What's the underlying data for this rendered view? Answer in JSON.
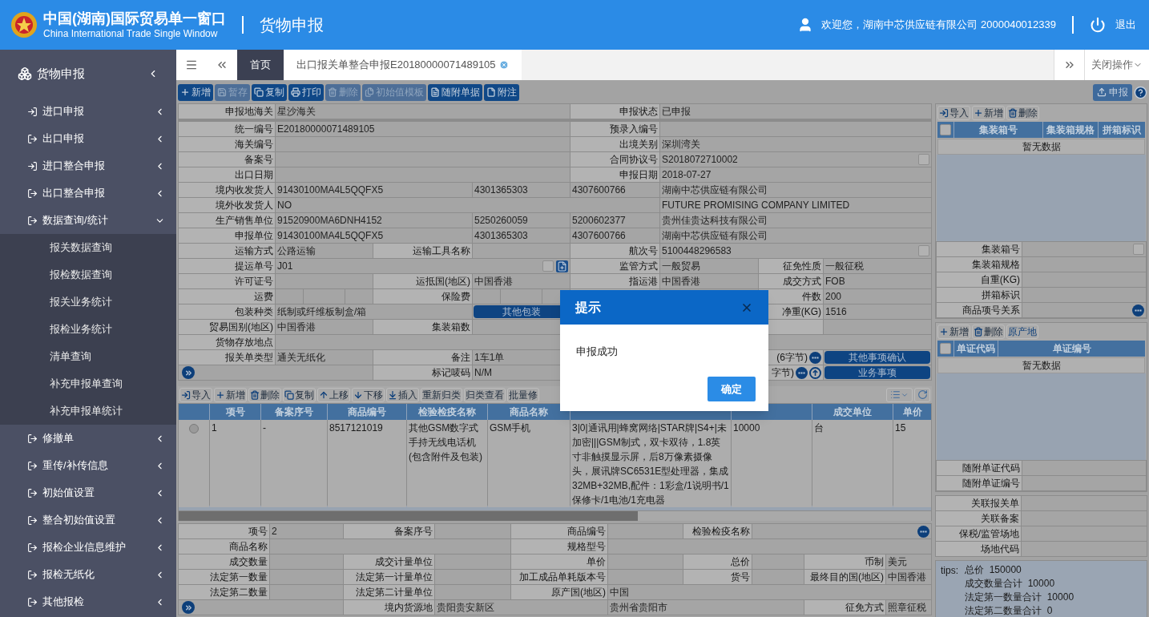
{
  "header": {
    "title": "中国(湖南)国际贸易单一窗口",
    "subtitle": "China International Trade Single Window",
    "page_title": "货物申报",
    "welcome": "欢迎您，湖南中芯供应链有限公司 2000040012339",
    "logout": "退出"
  },
  "sidebar": {
    "title": "货物申报",
    "items": [
      {
        "label": "进口申报",
        "expanded": false
      },
      {
        "label": "出口申报",
        "expanded": false
      },
      {
        "label": "进口整合申报",
        "expanded": false
      },
      {
        "label": "出口整合申报",
        "expanded": false
      },
      {
        "label": "数据查询/统计",
        "expanded": true,
        "children": [
          {
            "label": "报关数据查询"
          },
          {
            "label": "报检数据查询"
          },
          {
            "label": "报关业务统计"
          },
          {
            "label": "报检业务统计"
          },
          {
            "label": "清单查询"
          },
          {
            "label": "补充申报单查询"
          },
          {
            "label": "补充申报单统计"
          }
        ]
      },
      {
        "label": "修撤单",
        "expanded": false
      },
      {
        "label": "重传/补传信息",
        "expanded": false
      },
      {
        "label": "初始值设置",
        "expanded": false
      },
      {
        "label": "整合初始值设置",
        "expanded": false
      },
      {
        "label": "报检企业信息维护",
        "expanded": false
      },
      {
        "label": "报检无纸化",
        "expanded": false
      },
      {
        "label": "其他报检",
        "expanded": false
      }
    ]
  },
  "tabs": [
    {
      "label": "首页",
      "selected": false,
      "closable": false
    },
    {
      "label": "出口报关单整合申报E20180000071489105",
      "selected": true,
      "closable": true
    }
  ],
  "close_ops": "关闭操作",
  "toolbar": [
    {
      "label": "新增",
      "disabled": false
    },
    {
      "label": "暂存",
      "disabled": true
    },
    {
      "label": "复制",
      "disabled": false
    },
    {
      "label": "打印",
      "disabled": false
    },
    {
      "label": "删除",
      "disabled": true
    },
    {
      "label": "初始值模板",
      "disabled": true
    },
    {
      "label": "随附单据",
      "disabled": false
    },
    {
      "label": "附注",
      "disabled": false
    }
  ],
  "submit_button": "申报",
  "form": {
    "rows": [
      [
        {
          "kind": "label",
          "text": "申报地海关"
        },
        {
          "kind": "value",
          "text": "星沙海关"
        },
        "",
        "",
        {
          "kind": "label",
          "text": "申报状态"
        },
        {
          "kind": "value",
          "text": "已申报"
        },
        "",
        ""
      ],
      [
        {
          "kind": "label",
          "text": "统一编号"
        },
        {
          "kind": "value",
          "text": "E20180000071489105"
        },
        "",
        "",
        {
          "kind": "label",
          "text": "预录入编号"
        },
        {
          "kind": "value"
        },
        "",
        ""
      ],
      [
        {
          "kind": "label",
          "text": "海关编号"
        },
        {
          "kind": "value"
        },
        "",
        "",
        {
          "kind": "label",
          "text": "出境关别"
        },
        {
          "kind": "value",
          "text": "深圳湾关"
        },
        "",
        ""
      ],
      [
        {
          "kind": "label",
          "text": "备案号"
        },
        {
          "kind": "value"
        },
        "",
        "",
        {
          "kind": "label",
          "text": "合同协议号"
        },
        {
          "kind": "value",
          "text": "S2018072710002",
          "checked": false
        },
        "",
        ""
      ],
      [
        {
          "kind": "label",
          "text": "出口日期"
        },
        {
          "kind": "value"
        },
        "",
        "",
        {
          "kind": "label",
          "text": "申报日期"
        },
        {
          "kind": "value",
          "text": "2018-07-27"
        },
        "",
        ""
      ],
      [
        {
          "kind": "label",
          "text": "境内收发货人"
        },
        {
          "kind": "value",
          "text": "91430100MA4L5QQFX5"
        },
        "",
        {
          "kind": "value",
          "text": "4301365303"
        },
        {
          "kind": "value",
          "text": "4307600766"
        },
        {
          "kind": "value",
          "text": "湖南中芯供应链有限公司"
        },
        "",
        ""
      ],
      [
        {
          "kind": "label",
          "text": "境外收发货人"
        },
        {
          "kind": "value",
          "text": "NO"
        },
        "",
        "",
        "",
        {
          "kind": "value",
          "text": "FUTURE PROMISING COMPANY LIMITED"
        },
        "",
        ""
      ],
      [
        {
          "kind": "label",
          "text": "生产销售单位"
        },
        {
          "kind": "value",
          "text": "91520900MA6DNH4152"
        },
        "",
        {
          "kind": "value",
          "text": "5250260059"
        },
        {
          "kind": "value",
          "text": "5200602377"
        },
        {
          "kind": "value",
          "text": "贵州佳贵达科技有限公司"
        },
        "",
        ""
      ],
      [
        {
          "kind": "label",
          "text": "申报单位"
        },
        {
          "kind": "value",
          "text": "91430100MA4L5QQFX5"
        },
        "",
        {
          "kind": "value",
          "text": "4301365303"
        },
        {
          "kind": "value",
          "text": "4307600766"
        },
        {
          "kind": "value",
          "text": "湖南中芯供应链有限公司"
        },
        "",
        ""
      ],
      [
        {
          "kind": "label",
          "text": "运输方式"
        },
        {
          "kind": "value",
          "text": "公路运输"
        },
        {
          "kind": "label",
          "text": "运输工具名称"
        },
        {
          "kind": "value"
        },
        {
          "kind": "label",
          "text": "航次号"
        },
        {
          "kind": "value",
          "text": "5100448296583",
          "checked": false
        },
        "",
        ""
      ],
      [
        {
          "kind": "label",
          "text": "提运单号"
        },
        {
          "kind": "lookup",
          "text": "J01",
          "checked": false
        },
        "",
        "",
        {
          "kind": "label",
          "text": "监管方式"
        },
        {
          "kind": "value",
          "text": "一般贸易"
        },
        {
          "kind": "label",
          "text": "征免性质"
        },
        {
          "kind": "value",
          "text": "一般征税"
        }
      ],
      [
        {
          "kind": "label",
          "text": "许可证号"
        },
        {
          "kind": "value"
        },
        {
          "kind": "label",
          "text": "运抵国(地区)"
        },
        {
          "kind": "value",
          "text": "中国香港"
        },
        {
          "kind": "label",
          "text": "指运港"
        },
        {
          "kind": "value",
          "text": "中国香港"
        },
        {
          "kind": "label",
          "text": "成交方式"
        },
        {
          "kind": "value",
          "text": "FOB"
        }
      ],
      [
        {
          "kind": "label",
          "text": "运费"
        },
        {
          "kind": "split"
        },
        {
          "kind": "label",
          "text": "保险费"
        },
        {
          "kind": "split"
        },
        {
          "kind": "label"
        },
        {
          "kind": "value"
        },
        {
          "kind": "label",
          "text": "件数"
        },
        {
          "kind": "value",
          "text": "200"
        }
      ],
      [
        {
          "kind": "label",
          "text": "包装种类"
        },
        {
          "kind": "value",
          "text": "纸制或纤维板制盒/箱"
        },
        "",
        {
          "kind": "button",
          "text": "其他包装"
        },
        null,
        null,
        {
          "kind": "label",
          "text": "净重(KG)"
        },
        {
          "kind": "value",
          "text": "1516"
        }
      ],
      [
        {
          "kind": "label",
          "text": "贸易国别(地区)"
        },
        {
          "kind": "value",
          "text": "中国香港"
        },
        {
          "kind": "label",
          "text": "集装箱数"
        },
        {
          "kind": "value"
        },
        null,
        null,
        {
          "kind": "label"
        },
        {
          "kind": "value"
        }
      ],
      [
        {
          "kind": "label",
          "text": "货物存放地点"
        },
        {
          "kind": "value"
        },
        "",
        "",
        {
          "kind": "label"
        },
        {
          "kind": "value"
        },
        "",
        ""
      ],
      [
        {
          "kind": "label",
          "text": "报关单类型"
        },
        {
          "kind": "value",
          "text": "通关无纸化"
        },
        {
          "kind": "label",
          "text": "备注"
        },
        {
          "kind": "value",
          "text": "1车1单"
        },
        "",
        "",
        {
          "kind": "note",
          "text": "(6字节)",
          "extra_icon": false
        },
        {
          "kind": "button",
          "text": "其他事项确认"
        }
      ],
      [
        {
          "kind": "expand"
        },
        "",
        {
          "kind": "label",
          "text": "标记唛码"
        },
        {
          "kind": "value",
          "text": "N/M"
        },
        "",
        "",
        {
          "kind": "note",
          "text": "字节)",
          "extra_icon": true
        },
        {
          "kind": "button",
          "text": "业务事项"
        }
      ]
    ]
  },
  "goods_toolbar": [
    {
      "label": "导入"
    },
    {
      "label": "新增"
    },
    {
      "label": "删除"
    },
    {
      "label": "复制"
    },
    {
      "label": "上移"
    },
    {
      "label": "下移"
    },
    {
      "label": "插入"
    },
    {
      "label": "重新归类"
    },
    {
      "label": "归类查看"
    },
    {
      "label": "批量修"
    }
  ],
  "goods_table": {
    "columns": [
      {
        "label": "项号"
      },
      {
        "label": "备案序号"
      },
      {
        "label": "商品编号"
      },
      {
        "label": "检验检疫名称"
      },
      {
        "label": "商品名称"
      },
      {},
      {},
      {
        "label": "成交单位"
      },
      {
        "label": "单价"
      }
    ],
    "rows": [
      {
        "selected": false,
        "cells": [
          "1",
          "-",
          "8517121019",
          "其他GSM数字式手持无线电话机(包含附件及包装)",
          "GSM手机",
          "3|0|通讯用|蜂窝网络|STAR牌|S4+|未加密|||GSM制式，双卡双待，1.8英寸非触摸显示屏，后8万像素摄像头，展讯牌SC6531E型处理器，集成32MB+32MB,配件：1彩盒/1说明书/1保修卡/1电池/1充电器",
          "10000",
          "台",
          "15"
        ]
      }
    ]
  },
  "goods_form": {
    "rows": [
      [
        {
          "kind": "label",
          "text": "项号"
        },
        {
          "kind": "value",
          "text": "2"
        },
        {
          "kind": "label",
          "text": "备案序号"
        },
        {
          "kind": "value"
        },
        {
          "kind": "label",
          "text": "商品编号"
        },
        {
          "kind": "value"
        },
        {
          "kind": "label",
          "text": "检验检疫名称"
        },
        {
          "kind": "picker"
        },
        "",
        ""
      ],
      [
        {
          "kind": "label",
          "text": "商品名称"
        },
        {
          "kind": "value"
        },
        "",
        "",
        {
          "kind": "label",
          "text": "规格型号"
        },
        {
          "kind": "value"
        },
        "",
        "",
        "",
        ""
      ],
      [
        {
          "kind": "label",
          "text": "成交数量"
        },
        {
          "kind": "value"
        },
        {
          "kind": "label",
          "text": "成交计量单位"
        },
        {
          "kind": "value"
        },
        {
          "kind": "label",
          "text": "单价"
        },
        {
          "kind": "value"
        },
        {
          "kind": "label",
          "text": "总价"
        },
        {
          "kind": "value"
        },
        {
          "kind": "label",
          "text": "币制"
        },
        {
          "kind": "value",
          "text": "美元"
        }
      ],
      [
        {
          "kind": "label",
          "text": "法定第一数量"
        },
        {
          "kind": "value"
        },
        {
          "kind": "label",
          "text": "法定第一计量单位"
        },
        {
          "kind": "value"
        },
        {
          "kind": "label",
          "text": "加工成品单耗版本号"
        },
        {
          "kind": "value"
        },
        {
          "kind": "label",
          "text": "货号"
        },
        {
          "kind": "value"
        },
        {
          "kind": "label",
          "text": "最终目的国(地区)"
        },
        {
          "kind": "value",
          "text": "中国香港"
        }
      ],
      [
        {
          "kind": "label",
          "text": "法定第二数量"
        },
        {
          "kind": "value"
        },
        {
          "kind": "label",
          "text": "法定第二计量单位"
        },
        {
          "kind": "value"
        },
        {
          "kind": "label",
          "text": "原产国(地区)"
        },
        {
          "kind": "value",
          "text": "中国"
        },
        "",
        "",
        "",
        ""
      ],
      [
        {
          "kind": "expand"
        },
        "",
        {
          "kind": "label",
          "text": "境内货源地"
        },
        {
          "kind": "value",
          "text": "贵阳贵安新区"
        },
        "",
        {
          "kind": "value",
          "text": "贵州省贵阳市"
        },
        "",
        "",
        {
          "kind": "label",
          "text": "征免方式"
        },
        {
          "kind": "value",
          "text": "照章征税"
        }
      ]
    ]
  },
  "container_panel": {
    "toolbar": [
      {
        "label": "导入"
      },
      {
        "label": "新增"
      },
      {
        "label": "删除"
      }
    ],
    "select_all": {
      "checked": false
    },
    "columns": [
      {
        "label": "集装箱号"
      },
      {
        "label": "集装箱规格"
      },
      {
        "label": "拼箱标识"
      }
    ],
    "empty_text": "暂无数据",
    "form": {
      "rows": [
        [
          {
            "kind": "label",
            "text": "集装箱号"
          },
          {
            "kind": "value",
            "checked": false
          }
        ],
        [
          {
            "kind": "label",
            "text": "集装箱规格"
          },
          {
            "kind": "value"
          }
        ],
        [
          {
            "kind": "label",
            "text": "自重(KG)"
          },
          {
            "kind": "value"
          }
        ],
        [
          {
            "kind": "label",
            "text": "拼箱标识"
          },
          {
            "kind": "value"
          }
        ],
        [
          {
            "kind": "label",
            "text": "商品项号关系"
          },
          {
            "kind": "picker"
          }
        ]
      ]
    }
  },
  "document_panel": {
    "toolbar": [
      {
        "label": "新增"
      },
      {
        "label": "删除"
      },
      {
        "label": "原产地"
      }
    ],
    "select_all": {
      "checked": false
    },
    "columns": [
      {
        "label": "单证代码"
      },
      {
        "label": "单证编号"
      }
    ],
    "empty_text": "暂无数据",
    "form": {
      "rows": [
        [
          {
            "kind": "label",
            "text": "随附单证代码"
          },
          {
            "kind": "value"
          }
        ],
        [
          {
            "kind": "label",
            "text": "随附单证编号"
          },
          {
            "kind": "value"
          }
        ]
      ]
    }
  },
  "related_form": {
    "rows": [
      [
        {
          "kind": "label",
          "text": "关联报关单"
        },
        {
          "kind": "value"
        }
      ],
      [
        {
          "kind": "label",
          "text": "关联备案"
        },
        {
          "kind": "value"
        }
      ],
      [
        {
          "kind": "label",
          "text": "保税/监管场地"
        },
        {
          "kind": "value"
        }
      ],
      [
        {
          "kind": "label",
          "text": "场地代码"
        },
        {
          "kind": "value"
        }
      ]
    ]
  },
  "tips": {
    "label": "tips:",
    "lines": [
      "总价  150000",
      "成交数量合计  10000",
      "法定第一数量合计  10000",
      "法定第二数量合计  0"
    ]
  },
  "dialog": {
    "title": "提示",
    "message": "申报成功",
    "ok": "确定"
  }
}
